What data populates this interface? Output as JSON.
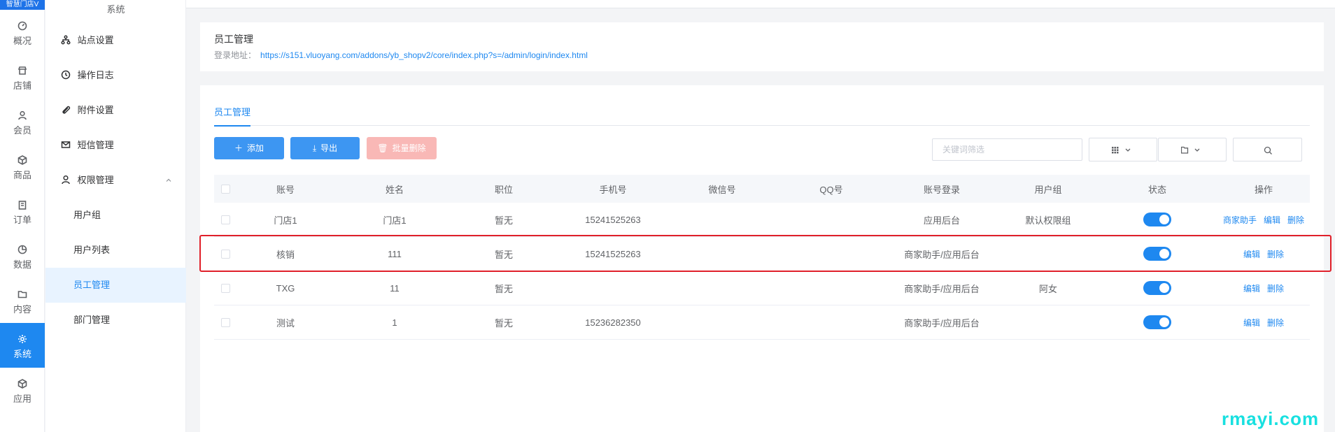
{
  "logo_text": "智慧门店V",
  "rail": [
    {
      "label": "概况",
      "icon": "dashboard-icon"
    },
    {
      "label": "店铺",
      "icon": "store-icon"
    },
    {
      "label": "会员",
      "icon": "user-icon"
    },
    {
      "label": "商品",
      "icon": "box-icon"
    },
    {
      "label": "订单",
      "icon": "clipboard-icon"
    },
    {
      "label": "数据",
      "icon": "pie-chart-icon"
    },
    {
      "label": "内容",
      "icon": "folder-icon"
    },
    {
      "label": "系统",
      "icon": "gear-icon"
    },
    {
      "label": "应用",
      "icon": "cube-icon"
    }
  ],
  "submenu": {
    "title": "系统",
    "items": [
      {
        "label": "站点设置",
        "icon": "sitemap-icon"
      },
      {
        "label": "操作日志",
        "icon": "history-icon"
      },
      {
        "label": "附件设置",
        "icon": "paperclip-icon"
      },
      {
        "label": "短信管理",
        "icon": "mail-icon"
      },
      {
        "label": "权限管理",
        "icon": "user-icon"
      }
    ],
    "children": [
      {
        "label": "用户组"
      },
      {
        "label": "用户列表"
      },
      {
        "label": "员工管理"
      },
      {
        "label": "部门管理"
      }
    ]
  },
  "header": {
    "title": "员工管理",
    "login_label": "登录地址：",
    "login_url": "https://s151.vluoyang.com/addons/yb_shopv2/core/index.php?s=/admin/login/index.html"
  },
  "tab": {
    "label": "员工管理"
  },
  "toolbar": {
    "add_label": "添加",
    "export_label": "导出",
    "batch_delete_label": "批量删除",
    "search_placeholder": "关键词筛选"
  },
  "table": {
    "columns": [
      "账号",
      "姓名",
      "职位",
      "手机号",
      "微信号",
      "QQ号",
      "账号登录",
      "用户组",
      "状态",
      "操作"
    ],
    "rows": [
      {
        "account": "门店1",
        "name": "门店1",
        "position": "暂无",
        "phone": "15241525263",
        "wechat": "",
        "qq": "",
        "login": "应用后台",
        "group": "默认权限组",
        "status": true,
        "ops": [
          "商家助手",
          "编辑",
          "删除"
        ]
      },
      {
        "account": "核销",
        "name": "111",
        "position": "暂无",
        "phone": "15241525263",
        "wechat": "",
        "qq": "",
        "login": "商家助手/应用后台",
        "group": "",
        "status": true,
        "ops": [
          "编辑",
          "删除"
        ]
      },
      {
        "account": "TXG",
        "name": "11",
        "position": "暂无",
        "phone": "",
        "wechat": "",
        "qq": "",
        "login": "商家助手/应用后台",
        "group": "阿女",
        "status": true,
        "ops": [
          "编辑",
          "删除"
        ]
      },
      {
        "account": "测试",
        "name": "1",
        "position": "暂无",
        "phone": "15236282350",
        "wechat": "",
        "qq": "",
        "login": "商家助手/应用后台",
        "group": "",
        "status": true,
        "ops": [
          "编辑",
          "删除"
        ]
      }
    ]
  },
  "watermark": "rmayi.com",
  "colors": {
    "accent": "#1e88f0",
    "danger_light": "#f9b8b6",
    "highlight": "#e0202a"
  }
}
